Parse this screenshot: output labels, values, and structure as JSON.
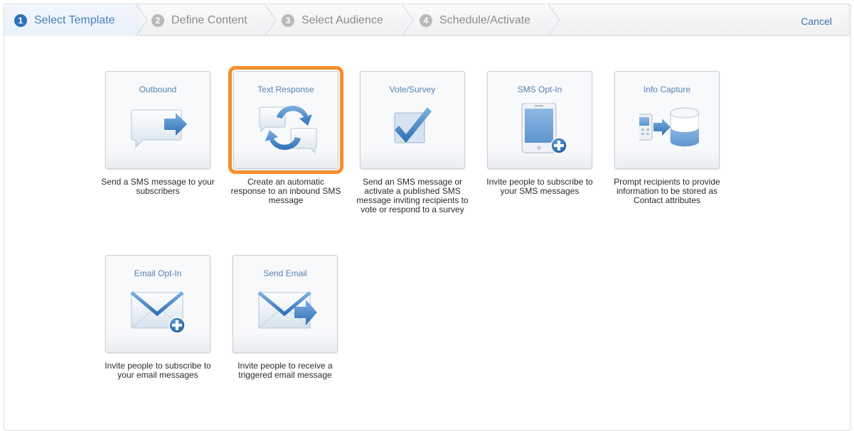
{
  "wizard": {
    "steps": [
      {
        "number": "1",
        "label": "Select Template",
        "active": true
      },
      {
        "number": "2",
        "label": "Define Content",
        "active": false
      },
      {
        "number": "3",
        "label": "Select Audience",
        "active": false
      },
      {
        "number": "4",
        "label": "Schedule/Activate",
        "active": false
      }
    ],
    "cancel_label": "Cancel"
  },
  "templates": [
    {
      "title": "Outbound",
      "icon": "chat-bubble-arrow-icon",
      "description": "Send a SMS message to your subscribers",
      "selected": false
    },
    {
      "title": "Text Response",
      "icon": "chat-bubbles-refresh-icon",
      "description": "Create an automatic response to an inbound SMS message",
      "selected": true
    },
    {
      "title": "Vote/Survey",
      "icon": "checkbox-checked-icon",
      "description": "Send an SMS message or activate a published SMS message inviting recipients to vote or respond to a survey",
      "selected": false
    },
    {
      "title": "SMS Opt-In",
      "icon": "phone-plus-icon",
      "description": "Invite people to subscribe to your SMS messages",
      "selected": false
    },
    {
      "title": "Info Capture",
      "icon": "phone-to-database-icon",
      "description": "Prompt recipients to provide information to be stored as Contact attributes",
      "selected": false
    },
    {
      "title": "Email Opt-In",
      "icon": "envelope-plus-icon",
      "description": "Invite people to subscribe to your email messages",
      "selected": false
    },
    {
      "title": "Send Email",
      "icon": "envelope-arrow-icon",
      "description": "Invite people to receive a triggered email message",
      "selected": false
    }
  ],
  "colors": {
    "accent": "#2f74b9",
    "selected_outline": "#f28f2d",
    "link": "#3d6fae"
  }
}
